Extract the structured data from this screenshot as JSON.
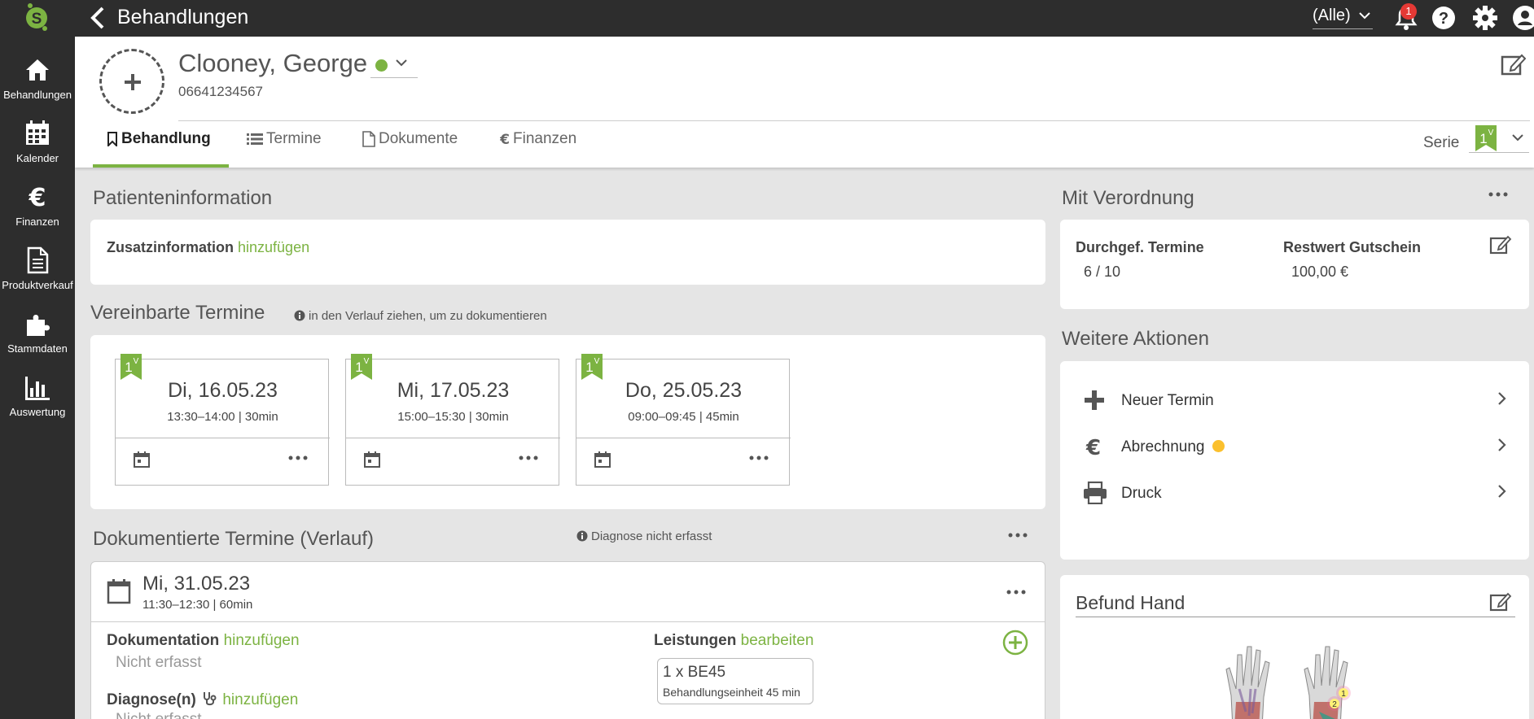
{
  "topbar": {
    "title": "Behandlungen",
    "filter_value": "(Alle)",
    "notification_count": "1",
    "logo_letter": "S"
  },
  "sidebar": {
    "items": [
      {
        "label": "Behandlungen",
        "icon": "home-icon"
      },
      {
        "label": "Kalender",
        "icon": "calendar-icon"
      },
      {
        "label": "Finanzen",
        "icon": "euro-icon"
      },
      {
        "label": "Produktverkauf",
        "icon": "document-icon"
      },
      {
        "label": "Stammdaten",
        "icon": "puzzle-icon"
      },
      {
        "label": "Auswertung",
        "icon": "bar-chart-icon"
      }
    ]
  },
  "patient": {
    "name": "Clooney, George",
    "phone": "06641234567",
    "status_color": "#7cb342"
  },
  "tabs": [
    {
      "label": "Behandlung",
      "icon": "bookmark-icon",
      "active": true
    },
    {
      "label": "Termine",
      "icon": "list-icon"
    },
    {
      "label": "Dokumente",
      "icon": "file-icon"
    },
    {
      "label": "Finanzen",
      "icon": "euro-icon"
    }
  ],
  "serie": {
    "label": "Serie",
    "badge": "1",
    "badge_sup": "V"
  },
  "patinfo": {
    "title": "Patienteninformation",
    "label": "Zusatzinformation",
    "link": "hinzufügen"
  },
  "termine": {
    "title": "Vereinbarte Termine",
    "hint": "in den Verlauf ziehen, um zu dokumentieren",
    "items": [
      {
        "date": "Di, 16.05.23",
        "time": "13:30–14:00 | 30min",
        "badge": "1",
        "badge_sup": "V"
      },
      {
        "date": "Mi, 17.05.23",
        "time": "15:00–15:30 | 30min",
        "badge": "1",
        "badge_sup": "V"
      },
      {
        "date": "Do, 25.05.23",
        "time": "09:00–09:45 | 45min",
        "badge": "1",
        "badge_sup": "V"
      }
    ]
  },
  "verlauf": {
    "title": "Dokumentierte Termine (Verlauf)",
    "hint": "Diagnose nicht erfasst",
    "entry": {
      "date": "Mi, 31.05.23",
      "time": "11:30–12:30 | 60min",
      "doku_label": "Dokumentation",
      "doku_link": "hinzufügen",
      "doku_value": "Nicht erfasst",
      "diag_label": "Diagnose(n)",
      "diag_link": "hinzufügen",
      "diag_value": "Nicht erfasst",
      "leist_label": "Leistungen",
      "leist_link": "bearbeiten",
      "leist_qty": "1 x BE45",
      "leist_desc": "Behandlungseinheit 45 min"
    }
  },
  "verordnung": {
    "title": "Mit Verordnung",
    "durch_label": "Durchgef. Termine",
    "durch_value": "6 / 10",
    "rest_label": "Restwert Gutschein",
    "rest_value": "100,00 €"
  },
  "aktionen": {
    "title": "Weitere Aktionen",
    "items": [
      {
        "label": "Neuer Termin",
        "icon": "plus-icon"
      },
      {
        "label": "Abrechnung",
        "icon": "euro-icon",
        "status_color": "#fbc02d"
      },
      {
        "label": "Druck",
        "icon": "printer-icon"
      }
    ]
  },
  "befund": {
    "title": "Befund Hand",
    "markers": [
      "1",
      "2"
    ]
  },
  "colors": {
    "accent": "#7cb342",
    "dark": "#2d2d2d",
    "warning": "#fbc02d",
    "badge": "#e53935"
  }
}
